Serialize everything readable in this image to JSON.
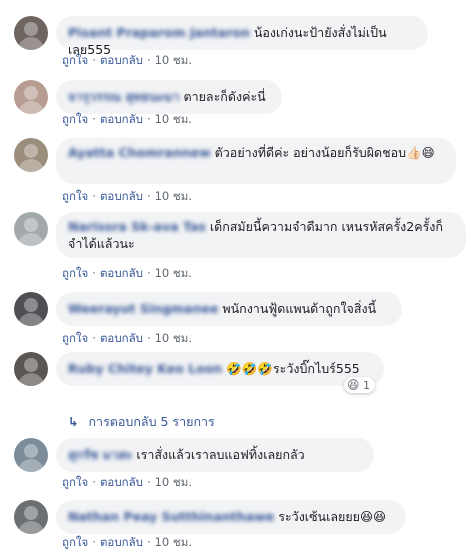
{
  "comments": [
    {
      "name": "Pisant Praparom Jantaron",
      "text": "น้องเก่งนะป้ายังสั่งไม่เป็นเลย555",
      "like": "ถูกใจ",
      "reply": "ตอบกลับ",
      "time": "10 ชม.",
      "avatar_color": "#6e6460"
    },
    {
      "name": "จารุวรรณ สุทธนะมา",
      "text": "ตายละก็ดังค่ะนี่",
      "like": "ถูกใจ",
      "reply": "ตอบกลับ",
      "time": "10 ชม.",
      "avatar_color": "#b79c92"
    },
    {
      "name": "Ayatta Chomrannew",
      "text": "ตัวอย่างที่ดีค่ะ อย่างน้อยก็รับผิดชอบ👍🏻😄",
      "like": "ถูกใจ",
      "reply": "ตอบกลับ",
      "time": "10 ชม.",
      "avatar_color": "#9b8d7c"
    },
    {
      "name": "Narissra Sk-ava Tas",
      "text": "เด็กสมัยนี้ความจำดีมาก เหนรหัสครั้ง2ครั้งก็จำได้แล้วนะ",
      "like": "ถูกใจ",
      "reply": "ตอบกลับ",
      "time": "10 ชม.",
      "avatar_color": "#a3a8ab"
    },
    {
      "name": "Weerayut Singmanee",
      "text": "พนักงานฟู้ดแพนด้าถูกใจสิ่งนี้",
      "like": "ถูกใจ",
      "reply": "ตอบกลับ",
      "time": "10 ชม.",
      "avatar_color": "#4e4f52"
    },
    {
      "name": "Ruby Chitey Keo Loon",
      "text": "🤣🤣🤣ระวังบิ๊กไบร์555",
      "like": "ถูกใจ",
      "reply": "ตอบกลับ",
      "time": "10 ชม.",
      "avatar_color": "#5b5652"
    },
    {
      "name": "สุกรัช มาสะ",
      "text": "เราสั่งแล้วเราลบแอฟทิ้งเลยกลัว",
      "like": "ถูกใจ",
      "reply": "ตอบกลับ",
      "time": "10 ชม.",
      "avatar_color": "#7d8c99"
    },
    {
      "name": "Nathan Peay Sutthinanthawe",
      "text": "ระวังเซ้นเลยยย😆😆",
      "like": "ถูกใจ",
      "reply": "ตอบกลับ",
      "time": "10 ชม.",
      "avatar_color": "#6c6f72"
    }
  ],
  "reaction": {
    "emoji": "😆",
    "count": "1"
  },
  "view_replies": "การตอบกลับ 5 รายการ"
}
